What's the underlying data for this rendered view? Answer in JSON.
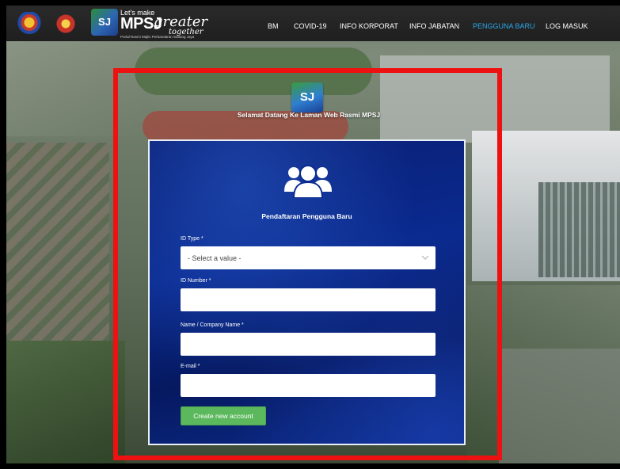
{
  "brand": {
    "lets_make": "Let's make",
    "name": "MPSJ",
    "tagline_1": "greater",
    "tagline_2": "together",
    "portal_caption": "Portal Rasmi Majlis Perbandaran Subang Jaya",
    "box_text": "SJ"
  },
  "nav": {
    "items": [
      {
        "label": "BM",
        "active": false
      },
      {
        "label": "COVID-19",
        "active": false
      },
      {
        "label": "INFO KORPORAT",
        "active": false
      },
      {
        "label": "INFO JABATAN",
        "active": false
      },
      {
        "label": "PENGGUNA BARU",
        "active": true
      },
      {
        "label": "LOG MASUK",
        "active": false
      }
    ]
  },
  "welcome": {
    "logo_text": "SJ",
    "text": "Selamat Datang Ke Laman Web Rasmi MPSJ"
  },
  "form": {
    "title": "Pendaftaran Pengguna Baru",
    "id_type_label": "ID Type *",
    "id_type_value": "- Select a value -",
    "id_number_label": "ID Number *",
    "id_number_value": "",
    "name_label": "Name / Company Name *",
    "name_value": "",
    "email_label": "E-mail *",
    "email_value": "",
    "submit_label": "Create new account"
  },
  "colors": {
    "nav_active": "#2aa7e8",
    "highlight": "#ee1111",
    "submit": "#5cb85c",
    "panel": "#0a2a8f"
  },
  "icons": [
    "users-icon",
    "chevron-down-icon"
  ]
}
